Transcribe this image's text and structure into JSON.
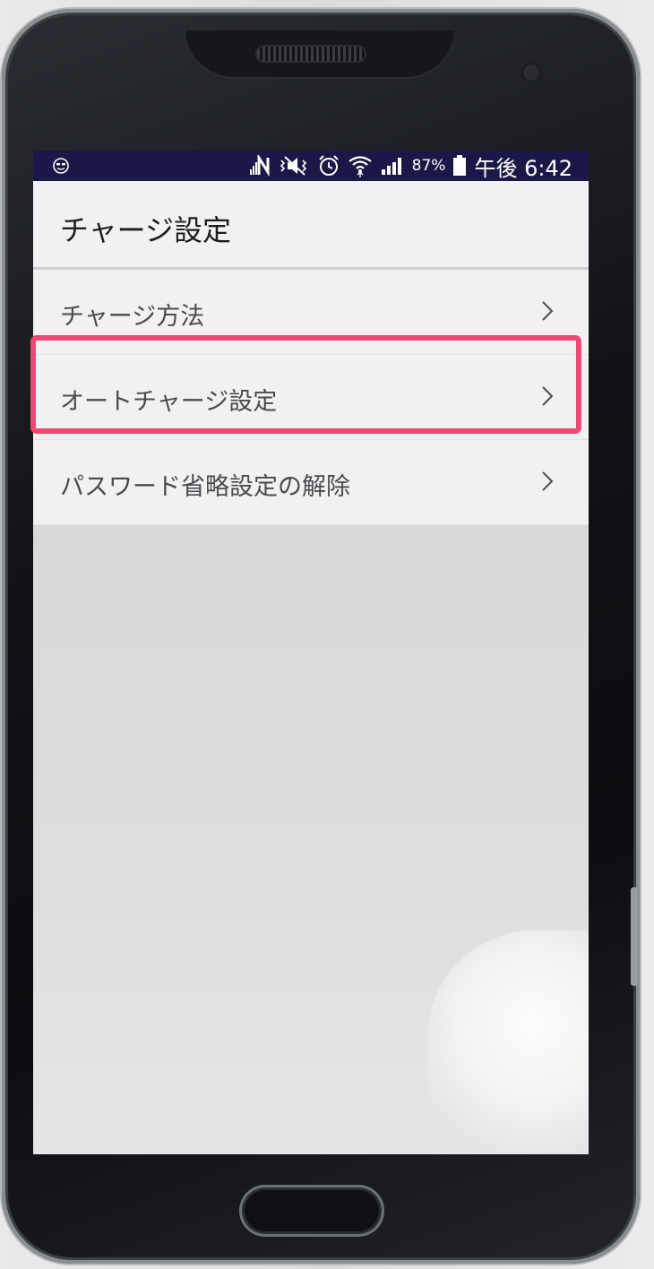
{
  "status_bar": {
    "left_icon": "smiley-icon",
    "icons": [
      "nfc-icon",
      "mute-icon",
      "alarm-icon",
      "wifi-icon",
      "signal-icon"
    ],
    "battery_percent": "87%",
    "time": "午後 6:42",
    "bg_color": "#1b1848"
  },
  "app_bar": {
    "title": "チャージ設定"
  },
  "menu": {
    "items": [
      {
        "label": "チャージ方法"
      },
      {
        "label": "オートチャージ設定"
      },
      {
        "label": "パスワード省略設定の解除"
      }
    ]
  },
  "highlight": {
    "target_item_index": 1,
    "color": "#ee4874"
  }
}
